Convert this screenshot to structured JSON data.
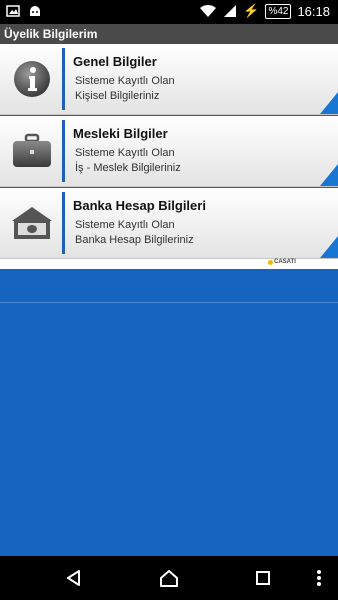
{
  "status_bar": {
    "time": "16:18",
    "battery": "%42"
  },
  "header": {
    "title": "Üyelik Bilgilerim"
  },
  "cards": [
    {
      "title": "Genel Bilgiler",
      "line1": "Sisteme Kayıtlı Olan",
      "line2": "Kişisel Bilgileriniz",
      "icon": "info-icon"
    },
    {
      "title": "Mesleki Bilgiler",
      "line1": "Sisteme Kayıtlı Olan",
      "line2": "İş - Meslek Bilgileriniz",
      "icon": "briefcase-icon"
    },
    {
      "title": "Banka Hesap Bilgileri",
      "line1": "Sisteme Kayıtlı Olan",
      "line2": "Banka Hesap Bilgileriniz",
      "icon": "money-icon"
    }
  ],
  "brand": {
    "logo_text": "CASATI"
  },
  "colors": {
    "accent": "#1565c0",
    "header_bg": "#4a4a4a",
    "card_bar": "#1e5fbf"
  }
}
